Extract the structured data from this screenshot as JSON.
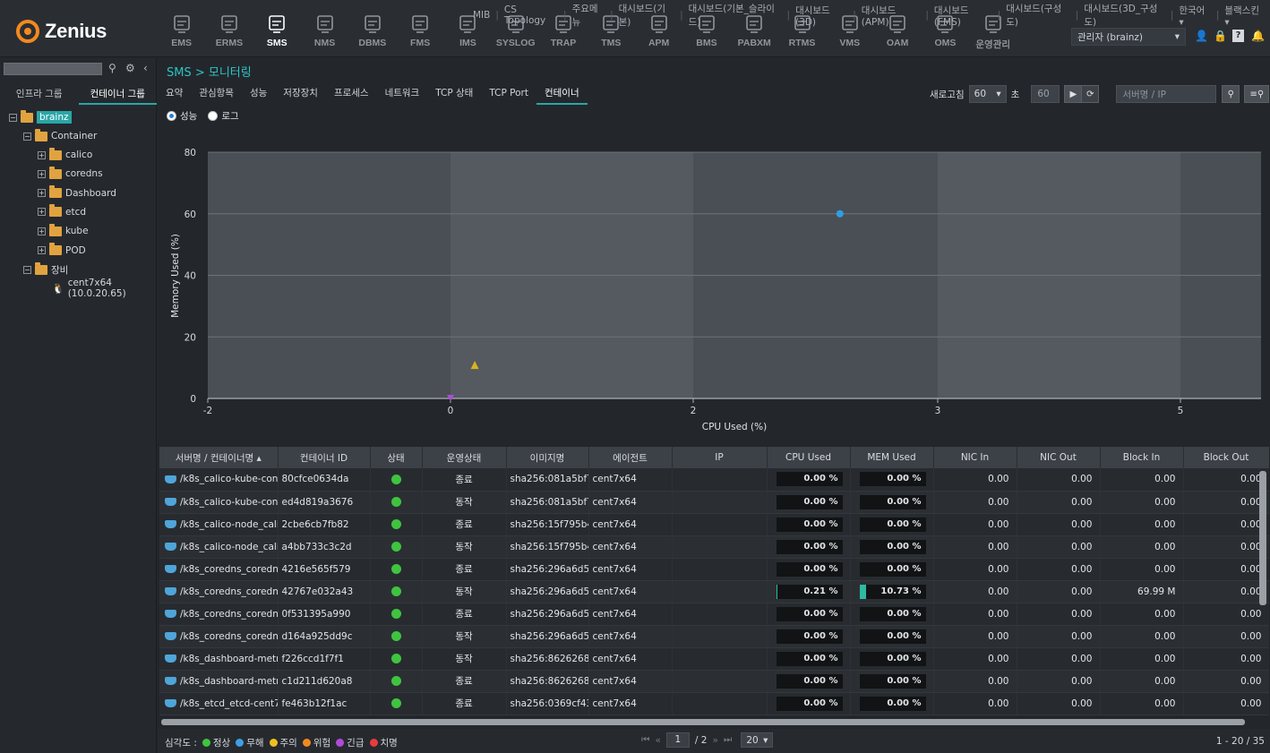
{
  "app": {
    "brand": "Zenius"
  },
  "modules": [
    {
      "label": "EMS",
      "icon": "ems-icon"
    },
    {
      "label": "ERMS",
      "icon": "erms-icon"
    },
    {
      "label": "SMS",
      "icon": "sms-icon"
    },
    {
      "label": "NMS",
      "icon": "nms-icon"
    },
    {
      "label": "DBMS",
      "icon": "dbms-icon"
    },
    {
      "label": "FMS",
      "icon": "fms-icon"
    },
    {
      "label": "IMS",
      "icon": "ims-icon"
    },
    {
      "label": "SYSLOG",
      "icon": "syslog-icon"
    },
    {
      "label": "TRAP",
      "icon": "trap-icon"
    },
    {
      "label": "TMS",
      "icon": "tms-icon"
    },
    {
      "label": "APM",
      "icon": "apm-icon"
    },
    {
      "label": "BMS",
      "icon": "bms-icon"
    },
    {
      "label": "PABXM",
      "icon": "pabxm-icon"
    },
    {
      "label": "RTMS",
      "icon": "rtms-icon"
    },
    {
      "label": "VMS",
      "icon": "vms-icon"
    },
    {
      "label": "OAM",
      "icon": "oam-icon"
    },
    {
      "label": "OMS",
      "icon": "oms-icon"
    },
    {
      "label": "운영관리",
      "icon": "operations-gear-icon"
    }
  ],
  "top_links": [
    "MIB",
    "CS Topology",
    "주요메뉴",
    "대시보드(기본)",
    "대시보드(기본_슬라이드)",
    "대시보드(3D)",
    "대시보드(APM)",
    "대시보드(FMS)",
    "대시보드(구성도)",
    "대시보드(3D_구성도)",
    "한국어 ▾",
    "블랙스킨 ▾"
  ],
  "user": {
    "label": "관리자 (brainz)"
  },
  "left_panel": {
    "tabs": [
      "인프라 그룹",
      "컨테이너 그룹"
    ],
    "tree": {
      "root": "brainz",
      "container": "Container",
      "groups": [
        "calico",
        "coredns",
        "Dashboard",
        "etcd",
        "kube",
        "POD"
      ],
      "device_group": "장비",
      "device": "cent7x64 (10.0.20.65)"
    }
  },
  "breadcrumb": "SMS > 모니터링",
  "tabs": [
    "요약",
    "관심항목",
    "성능",
    "저장장치",
    "프로세스",
    "네트워크",
    "TCP 상태",
    "TCP Port",
    "컨테이너"
  ],
  "refresh": {
    "label": "새로고침",
    "value": "60",
    "unit": "초",
    "seconds_field": "60"
  },
  "search": {
    "placeholder": "서버명 / IP"
  },
  "view_mode": {
    "performance": "성능",
    "log": "로그"
  },
  "chart_data": {
    "type": "scatter",
    "xlabel": "CPU Used (%)",
    "ylabel": "Memory Used (%)",
    "x_ticks": [
      "-2",
      "0",
      "2",
      "3",
      "5"
    ],
    "y_ticks": [
      "0",
      "20",
      "40",
      "60",
      "80"
    ],
    "ylim": [
      0,
      80
    ],
    "points": [
      {
        "x": 2.6,
        "y": 60,
        "shape": "circle",
        "color": "#2e9fe6"
      },
      {
        "x": 0.2,
        "y": 10.73,
        "shape": "triangle",
        "color": "#d9b31f"
      },
      {
        "x": 0.0,
        "y": 0.0,
        "shape": "triangle-down",
        "color": "#b04ad8"
      }
    ]
  },
  "table": {
    "columns": [
      "서버명 / 컨테이너명 ▴",
      "컨테이너 ID",
      "상태",
      "운영상태",
      "이미지명",
      "에이전트",
      "IP",
      "CPU Used",
      "MEM Used",
      "NIC In",
      "NIC Out",
      "Block In",
      "Block Out"
    ],
    "rows": [
      {
        "name": "/k8s_calico-kube-contro",
        "id": "80cfce0634da",
        "op": "종료",
        "image": "sha256:081a5bf738",
        "agent": "cent7x64",
        "ip": "",
        "cpu": "0.00 %",
        "cpu_pct": 0,
        "mem": "0.00 %",
        "mem_pct": 0,
        "nic_in": "0.00",
        "nic_out": "0.00",
        "block_in": "0.00",
        "block_out": "0.00"
      },
      {
        "name": "/k8s_calico-kube-contro",
        "id": "ed4d819a3676",
        "op": "동작",
        "image": "sha256:081a5bf738",
        "agent": "cent7x64",
        "ip": "",
        "cpu": "0.00 %",
        "cpu_pct": 0,
        "mem": "0.00 %",
        "mem_pct": 0,
        "nic_in": "0.00",
        "nic_out": "0.00",
        "block_in": "0.00",
        "block_out": "0.00"
      },
      {
        "name": "/k8s_calico-node_calico-",
        "id": "2cbe6cb7fb82",
        "op": "종료",
        "image": "sha256:15f795b449",
        "agent": "cent7x64",
        "ip": "",
        "cpu": "0.00 %",
        "cpu_pct": 0,
        "mem": "0.00 %",
        "mem_pct": 0,
        "nic_in": "0.00",
        "nic_out": "0.00",
        "block_in": "0.00",
        "block_out": "0.00"
      },
      {
        "name": "/k8s_calico-node_calico-",
        "id": "a4bb733c3c2d",
        "op": "동작",
        "image": "sha256:15f795b449",
        "agent": "cent7x64",
        "ip": "",
        "cpu": "0.00 %",
        "cpu_pct": 0,
        "mem": "0.00 %",
        "mem_pct": 0,
        "nic_in": "0.00",
        "nic_out": "0.00",
        "block_in": "0.00",
        "block_out": "0.00"
      },
      {
        "name": "/k8s_coredns_coredns-5",
        "id": "4216e565f579",
        "op": "종료",
        "image": "sha256:296a6d5035",
        "agent": "cent7x64",
        "ip": "",
        "cpu": "0.00 %",
        "cpu_pct": 0,
        "mem": "0.00 %",
        "mem_pct": 0,
        "nic_in": "0.00",
        "nic_out": "0.00",
        "block_in": "0.00",
        "block_out": "0.00"
      },
      {
        "name": "/k8s_coredns_coredns-5",
        "id": "42767e032a43",
        "op": "동작",
        "image": "sha256:296a6d5035",
        "agent": "cent7x64",
        "ip": "",
        "cpu": "0.21 %",
        "cpu_pct": 0.21,
        "mem": "10.73 %",
        "mem_pct": 10.73,
        "nic_in": "0.00",
        "nic_out": "0.00",
        "block_in": "69.99 M",
        "block_out": "0.00"
      },
      {
        "name": "/k8s_coredns_coredns-5",
        "id": "0f531395a990",
        "op": "종료",
        "image": "sha256:296a6d5035",
        "agent": "cent7x64",
        "ip": "",
        "cpu": "0.00 %",
        "cpu_pct": 0,
        "mem": "0.00 %",
        "mem_pct": 0,
        "nic_in": "0.00",
        "nic_out": "0.00",
        "block_in": "0.00",
        "block_out": "0.00"
      },
      {
        "name": "/k8s_coredns_coredns-5",
        "id": "d164a925dd9c",
        "op": "동작",
        "image": "sha256:296a6d5035",
        "agent": "cent7x64",
        "ip": "",
        "cpu": "0.00 %",
        "cpu_pct": 0,
        "mem": "0.00 %",
        "mem_pct": 0,
        "nic_in": "0.00",
        "nic_out": "0.00",
        "block_in": "0.00",
        "block_out": "0.00"
      },
      {
        "name": "/k8s_dashboard-metrics",
        "id": "f226ccd1f7f1",
        "op": "동작",
        "image": "sha256:86262685d",
        "agent": "cent7x64",
        "ip": "",
        "cpu": "0.00 %",
        "cpu_pct": 0,
        "mem": "0.00 %",
        "mem_pct": 0,
        "nic_in": "0.00",
        "nic_out": "0.00",
        "block_in": "0.00",
        "block_out": "0.00"
      },
      {
        "name": "/k8s_dashboard-metrics",
        "id": "c1d211d620a8",
        "op": "종료",
        "image": "sha256:86262685d",
        "agent": "cent7x64",
        "ip": "",
        "cpu": "0.00 %",
        "cpu_pct": 0,
        "mem": "0.00 %",
        "mem_pct": 0,
        "nic_in": "0.00",
        "nic_out": "0.00",
        "block_in": "0.00",
        "block_out": "0.00"
      },
      {
        "name": "/k8s_etcd_etcd-cent7x64",
        "id": "fe463b12f1ac",
        "op": "종료",
        "image": "sha256:0369cf4303",
        "agent": "cent7x64",
        "ip": "",
        "cpu": "0.00 %",
        "cpu_pct": 0,
        "mem": "0.00 %",
        "mem_pct": 0,
        "nic_in": "0.00",
        "nic_out": "0.00",
        "block_in": "0.00",
        "block_out": "0.00"
      }
    ]
  },
  "footer": {
    "legend_label": "심각도 :",
    "legend": [
      {
        "label": "정상",
        "color": "#3fc43f"
      },
      {
        "label": "무해",
        "color": "#3f9fe6"
      },
      {
        "label": "주의",
        "color": "#f0c020"
      },
      {
        "label": "위험",
        "color": "#f08a20"
      },
      {
        "label": "긴급",
        "color": "#b04ad8"
      },
      {
        "label": "치명",
        "color": "#e83c3c"
      }
    ],
    "page": "1",
    "page_total": "/ 2",
    "page_size": "20",
    "count": "1 - 20 / 35"
  }
}
